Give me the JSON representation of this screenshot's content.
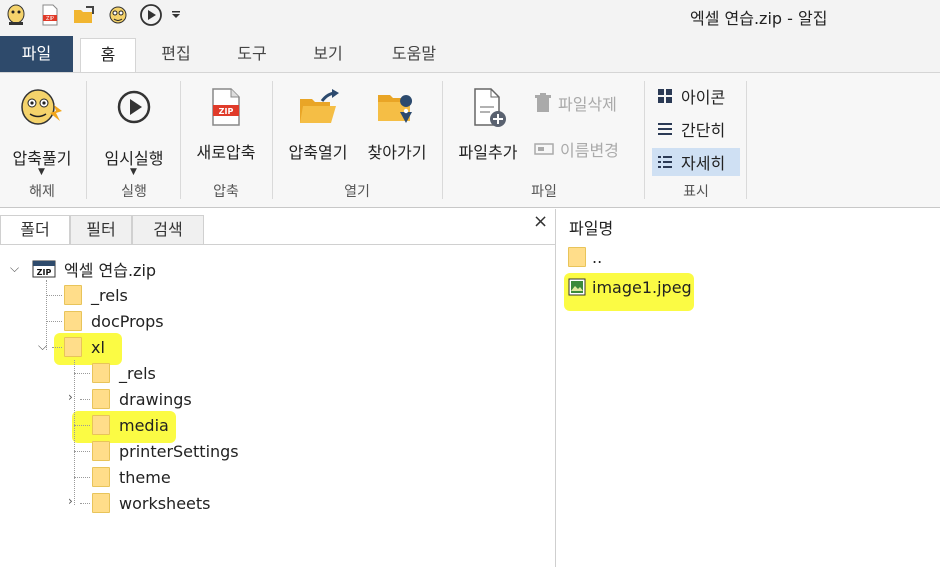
{
  "window": {
    "title": "엑셀 연습.zip - 알집"
  },
  "quick_access": [
    "alzip-logo-icon",
    "zip-file-icon",
    "folder-open-icon",
    "alzip-mascot-icon",
    "play-icon"
  ],
  "ribbon_tabs": [
    {
      "label": "파일"
    },
    {
      "label": "홈"
    },
    {
      "label": "편집"
    },
    {
      "label": "도구"
    },
    {
      "label": "보기"
    },
    {
      "label": "도움말"
    }
  ],
  "ribbon": {
    "extract": {
      "label": "압축풀기",
      "group": "해제"
    },
    "run": {
      "label": "임시실행",
      "group": "실행"
    },
    "new_zip": {
      "label": "새로압축",
      "group": "압축"
    },
    "open_zip": {
      "label": "압축열기"
    },
    "browse": {
      "label": "찾아가기"
    },
    "open_group": "열기",
    "add_file": {
      "label": "파일추가"
    },
    "delete_file": {
      "label": "파일삭제"
    },
    "rename": {
      "label": "이름변경"
    },
    "file_group": "파일",
    "view_icon": {
      "label": "아이콘"
    },
    "view_simple": {
      "label": "간단히"
    },
    "view_detail": {
      "label": "자세히"
    },
    "view_group": "표시"
  },
  "left_panel": {
    "tabs": [
      {
        "label": "폴더"
      },
      {
        "label": "필터"
      },
      {
        "label": "검색"
      }
    ],
    "close": "×",
    "tree": {
      "root": "엑셀 연습.zip",
      "items": [
        {
          "label": "_rels"
        },
        {
          "label": "docProps"
        },
        {
          "label": "xl"
        },
        {
          "label": "_rels"
        },
        {
          "label": "drawings"
        },
        {
          "label": "media"
        },
        {
          "label": "printerSettings"
        },
        {
          "label": "theme"
        },
        {
          "label": "worksheets"
        }
      ]
    }
  },
  "right_panel": {
    "column_header": "파일명",
    "files": [
      {
        "name": ".."
      },
      {
        "name": "image1.jpeg"
      }
    ]
  },
  "colors": {
    "file_tab": "#2e4a6b",
    "highlight": "#fbfb44",
    "folder": "#ffdd8a",
    "selected_view": "#cfe0f3"
  }
}
